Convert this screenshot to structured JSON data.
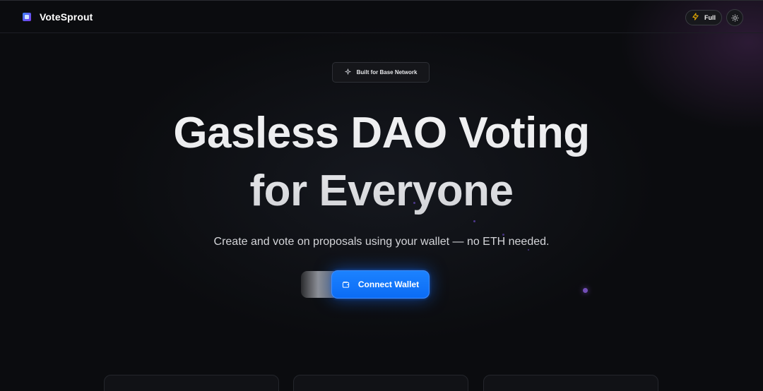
{
  "header": {
    "brand_name": "VoteSprout",
    "mode_label": "Full",
    "icons": {
      "logo": "votesprout-logo-icon",
      "mode": "lightning-bolt-icon",
      "theme_toggle": "sun-icon"
    }
  },
  "badge": {
    "label": "Built for Base Network",
    "icon": "sparkle-icon"
  },
  "hero": {
    "title_line1": "Gasless DAO Voting",
    "title_line2": "for Everyone",
    "subtitle": "Create and vote on proposals using your wallet — no ETH needed."
  },
  "cta": {
    "connect_label": "Connect Wallet",
    "connect_icon": "wallet-icon"
  },
  "colors": {
    "background": "#0b0c0f",
    "accent_blue": "#1877ff",
    "bolt_yellow": "#f5b400",
    "particle_purple": "#8a5cff"
  }
}
